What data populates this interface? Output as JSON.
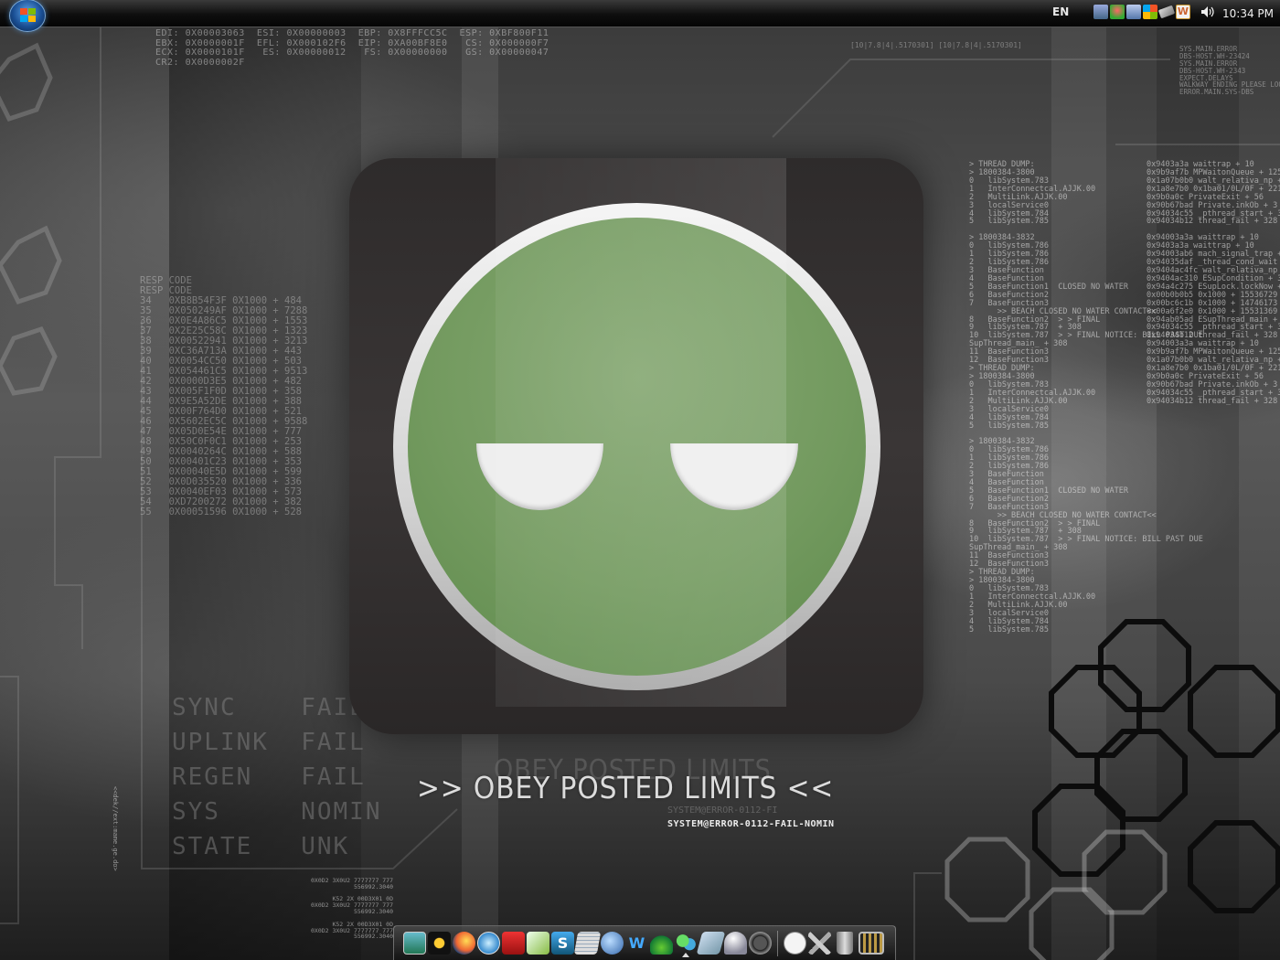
{
  "taskbar": {
    "start_button": "Start",
    "language": "EN",
    "clock": "10:34 PM",
    "tray_icons": [
      "network-icon",
      "user-icon",
      "display-icon",
      "windows-flag-icon",
      "battery-icon",
      "word-icon"
    ],
    "volume_icon": "speaker-icon"
  },
  "wallpaper": {
    "motto": ">> OBEY POSTED LIMITS <<",
    "motto_echo": "OBEY POSTED LIMITS",
    "subtitle": "SYSTEM@ERROR-0112-FAIL-NOMIN",
    "subtitle_echo": "SYSTEM@ERROR-0112-FI",
    "status_lines": "SYNC    FAIL\nUPLINK  FAIL\nREGEN   FAIL\nSYS     NOMIN\nSTATE   UNK",
    "vertical_label": "<<dek//ext:mame.ge.do>",
    "registers": "EDI: 0X00003063  ESI: 0X00000003  EBP: 0X8FFFCC5C  ESP: 0XBF800F11\nEBX: 0X0000001F  EFL: 0X000102F6  EIP: 0XA00BF8E0   CS: 0X000000F7\nECX: 0X0000101F   ES: 0X00000012   FS: 0X00000000   GS: 0X00000047\nCR2: 0X0000002F",
    "resp_code": "RESP CODE\nRESP CODE\n34   0XB8B54F3F 0X1000 + 484\n35   0X050249AF 0X1000 + 7288\n36   0X0E4A86C5 0X1000 + 1553\n37   0X2E25C58C 0X1000 + 1323\n38   0X00522941 0X1000 + 3213\n39   0XC36A713A 0X1000 + 443\n40   0X0054CC50 0X1000 + 503\n41   0X054461C5 0X1000 + 9513\n42   0X0000D3E5 0X1000 + 482\n43   0X005F1F0D 0X1000 + 358\n44   0X9E5A52DE 0X1000 + 388\n45   0X00F764D0 0X1000 + 521\n46   0X5602EC5C 0X1000 + 9588\n47   0X05D0E54E 0X1000 + 777\n48   0X50C0F0C1 0X1000 + 253\n49   0X0040264C 0X1000 + 588\n50   0X00401C23 0X1000 + 353\n51   0X00040E5D 0X1000 + 599\n52   0X0D035520 0X1000 + 336\n53   0X0040EF03 0X1000 + 573\n54   0XD7200272 0X1000 + 382\n55   0X00051596 0X1000 + 528",
    "thread_dump": "> THREAD DUMP:\n> 1800384-3800\n0   libSystem.783\n1   InterConnectcal.AJJK.00\n2   MultiLink.AJJK.00\n3   localService0\n4   libSystem.784\n5   libSystem.785\n\n> 1800384-3832\n0   libSystem.786\n1   libSystem.786\n2   libSystem.786\n3   BaseFunction\n4   BaseFunction\n5   BaseFunction1  CLOSED NO WATER\n6   BaseFunction2\n7   BaseFunction3\n      >> BEACH CLOSED NO WATER CONTACT<<\n8   BaseFunction2  > > FINAL\n9   libSystem.787  + 308\n10  libSystem.787  > > FINAL NOTICE: BILL PAST DUE\nSupThread_main_ + 308\n11  BaseFunction3\n12  BaseFunction3\n> THREAD DUMP:\n> 1800384-3800\n0   libSystem.783\n1   InterConnectcal.AJJK.00\n2   MultiLink.AJJK.00\n3   localService0\n4   libSystem.784\n5   libSystem.785\n\n> 1800384-3832\n0   libSystem.786\n1   libSystem.786\n2   libSystem.786\n3   BaseFunction\n4   BaseFunction\n5   BaseFunction1  CLOSED NO WATER\n6   BaseFunction2\n7   BaseFunction3\n      >> BEACH CLOSED NO WATER CONTACT<<\n8   BaseFunction2  > > FINAL\n9   libSystem.787  + 308\n10  libSystem.787  > > FINAL NOTICE: BILL PAST DUE\nSupThread_main_ + 308\n11  BaseFunction3\n12  BaseFunction3\n> THREAD DUMP:\n> 1800384-3800\n0   libSystem.783\n1   InterConnectcal.AJJK.00\n2   MultiLink.AJJK.00\n3   localService0\n4   libSystem.784\n5   libSystem.785",
    "thread_addresses": "0x9403a3a waittrap + 10\n0x9b9af7b MPWaitonQueue + 125\n0x1a07b0b0 walt_relativa_np + 2\n0x1a8e7b0 0x1ba01/0L/0F + 221\n0x9b0a0c PrivateExit + 56\n0x90b67bad Private.inkOb + 3\n0x94034c55 _pthread_start + 32\n0x94034b12 thread_fail + 328\n\n0x94003a3a waittrap + 10\n0x9403a3a waittrap + 10\n0x94003ab6 mach_signal_trap + 10\n0x94035daf _thread_cond_wait + 1\n0x9404ac4fc walt_relativa_np + 2\n0x9404ac310 ESupCondition + 3\n0x94a4c275 ESupLock.lockNow + 59\n0x00b0b0b5 0x1000 + 15536729\n0x00bc6c1b 0x1000 + 14746173\n0x00a6f2e0 0x1000 + 15531369\n0x94ab05ad ESupThread_main + 45\n0x94034c55 _pthread_start + 32\n0x94034b12 thread_fail + 328\n0x94003a3a waittrap + 10\n0x9b9af7b MPWaitonQueue + 125\n0x1a07b0b0 walt_relativa_np + 2\n0x1a8e7b0 0x1ba01/0L/0F + 221\n0x9b0a0c PrivateExit + 56\n0x90b67bad Private.inkOb + 3\n0x94034c55 _pthread_start + 32\n0x94034b12 thread_fail + 328",
    "sys_main": "SYS.MAIN.ERROR\nDBS-HOST.WH-23424\nSYS.MAIN.ERROR\nDBS-HOST.WH-2343\nEXPECT.DELAYS\nWALKWAY ENDING PLEASE LOOK\nERROR.MAIN.SYS-DBS",
    "strip_text": "[10|7.8|4|.5170301] [10|7.8|4|.5170301]",
    "address_bottom": "0X0D2 3X0U2 7777777 777\n556992.3040\n\nK52 2X 00D3X01 0D\n0X0D2 3X0U2 7777777 777\n556992.3040\n\nK52 2X 00D3X01 0D\n0X0D2 3X0U2 7777777 777\n556992.3040"
  },
  "dock": {
    "items": [
      "monitor-icon",
      "sun-icon",
      "firefox-icon",
      "safari-icon",
      "download-icon",
      "notepad-icon",
      "skype-icon",
      "spreadsheet-icon",
      "globe-icon",
      "writer-icon",
      "plant-icon",
      "messenger-icon",
      "disk-icon",
      "satellite-dish-icon",
      "clock-icon",
      "dashboard-icon",
      "tools-icon",
      "recycle-bin-icon",
      "film-icon"
    ]
  },
  "colors": {
    "face_green": "#739a5f",
    "ring_white": "#e6e6e6",
    "tile_dark": "#2f2c2c",
    "taskbar": "#0e0e0e"
  }
}
